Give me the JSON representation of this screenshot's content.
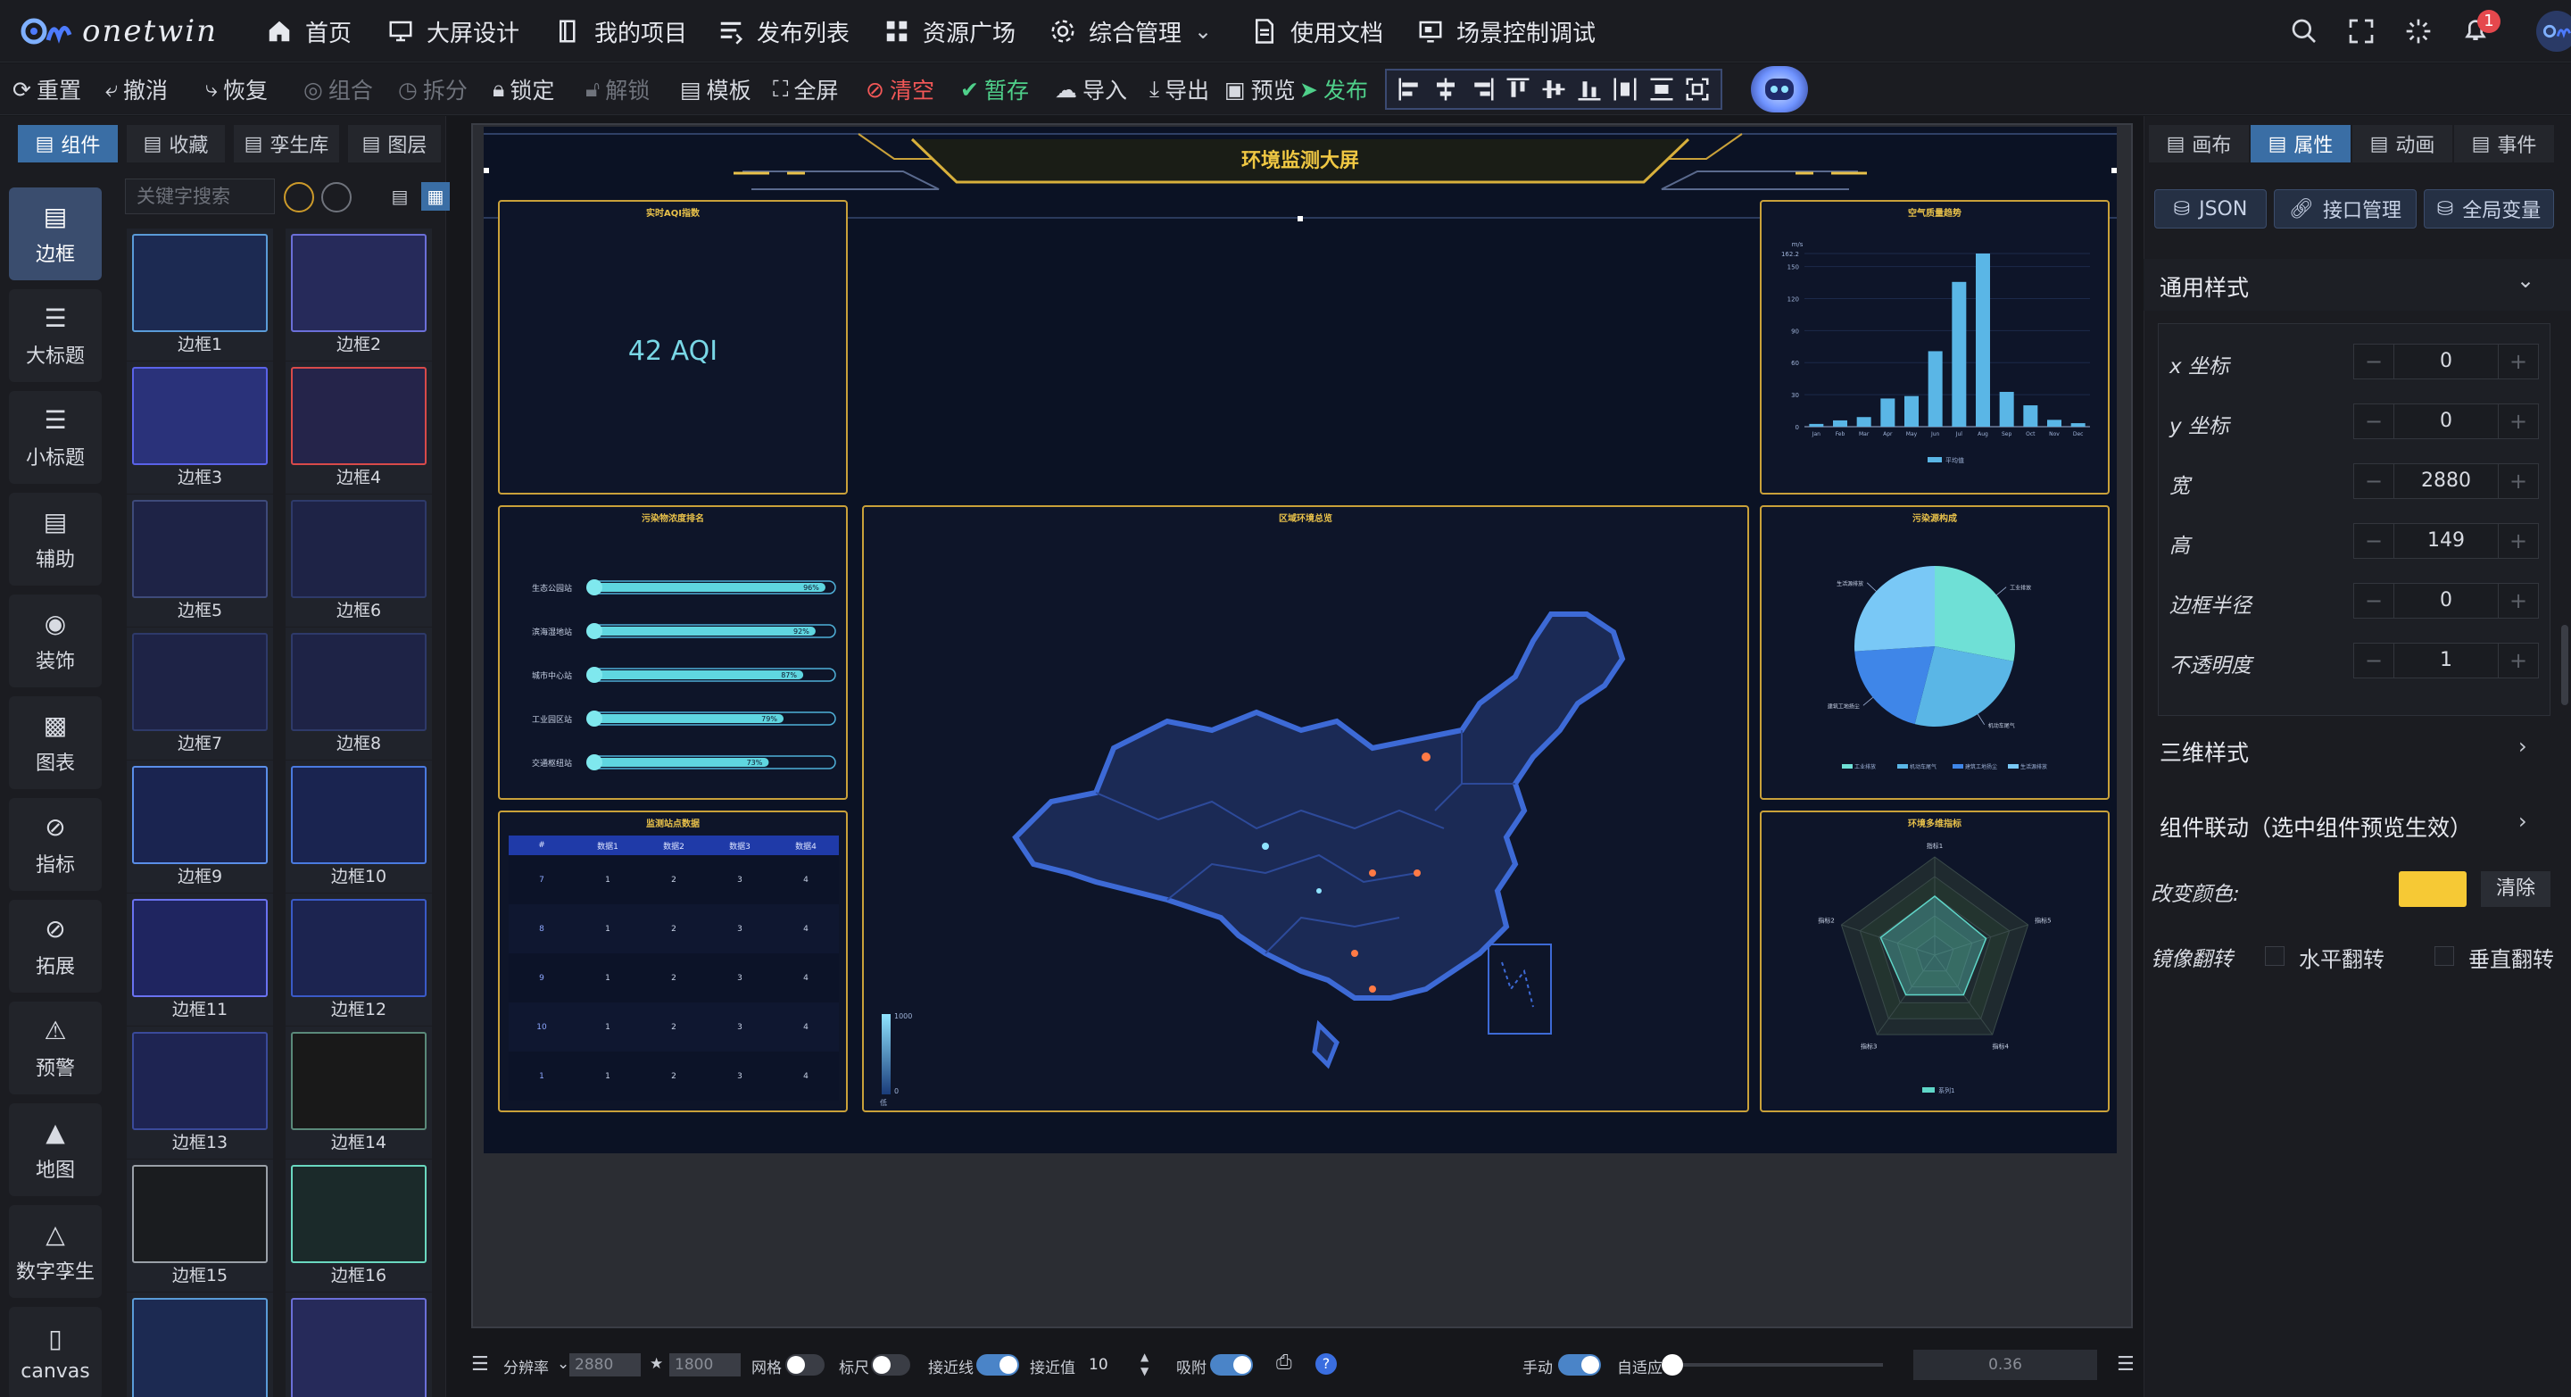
{
  "app": {
    "logo_text": "onetwin"
  },
  "nav": {
    "items": [
      "首页",
      "大屏设计",
      "我的项目",
      "发布列表",
      "资源广场",
      "综合管理",
      "使用文档",
      "场景控制调试"
    ],
    "notification_count": "1"
  },
  "toolbar": {
    "items": [
      "重置",
      "撤消",
      "恢复",
      "组合",
      "拆分",
      "锁定",
      "解锁",
      "模板",
      "全屏",
      "清空",
      "暂存",
      "导入",
      "导出",
      "预览",
      "发布"
    ]
  },
  "left_categories": [
    "边框",
    "大标题",
    "小标题",
    "辅助",
    "装饰",
    "图表",
    "指标",
    "拓展",
    "预警",
    "地图",
    "数字孪生",
    "canvas"
  ],
  "left_tabs": [
    "组件",
    "收藏",
    "孪生库",
    "图层"
  ],
  "search": {
    "placeholder": "关键字搜索"
  },
  "components": [
    "边框1",
    "边框2",
    "边框3",
    "边框4",
    "边框5",
    "边框6",
    "边框7",
    "边框8",
    "边框9",
    "边框10",
    "边框11",
    "边框12",
    "边框13",
    "边框14",
    "边框15",
    "边框16"
  ],
  "screen": {
    "title": "环境监测大屏",
    "aqi_panel_title": "实时AQI指数",
    "aqi_value": "42 AQI",
    "air_panel_title": "空气质量趋势",
    "rank_panel_title": "污染物浓度排名",
    "map_panel_title": "区域环境总览",
    "pie_panel_title": "污染源构成",
    "table_panel_title": "监测站点数据",
    "radar_panel_title": "环境多维指标",
    "map_scale_max": "1000",
    "map_scale_min": "0",
    "map_scale_label": "低",
    "table_headers": [
      "#",
      "数据1",
      "数据2",
      "数据3",
      "数据4"
    ]
  },
  "rank_data": {
    "type": "bar",
    "categories": [
      "生态公园站",
      "滨海湿地站",
      "城市中心站",
      "工业园区站",
      "交通枢纽站"
    ],
    "values": [
      96,
      92,
      87,
      79,
      73
    ],
    "value_labels": [
      "96%",
      "92%",
      "87%",
      "79%",
      "73%"
    ]
  },
  "table_rows": [
    [
      "7",
      "1",
      "2",
      "3",
      "4"
    ],
    [
      "8",
      "1",
      "2",
      "3",
      "4"
    ],
    [
      "9",
      "1",
      "2",
      "3",
      "4"
    ],
    [
      "10",
      "1",
      "2",
      "3",
      "4"
    ],
    [
      "1",
      "1",
      "2",
      "3",
      "4"
    ]
  ],
  "chart_data": [
    {
      "type": "bar",
      "title": "空气质量趋势",
      "ylabel": "m/s",
      "categories": [
        "Jan",
        "Feb",
        "Mar",
        "Apr",
        "May",
        "Jun",
        "Jul",
        "Aug",
        "Sep",
        "Oct",
        "Nov",
        "Dec"
      ],
      "yticks": [
        "0",
        "30",
        "60",
        "90",
        "120",
        "150",
        "162.2"
      ],
      "ylim": [
        0,
        162.2
      ],
      "series": [
        {
          "name": "平均值",
          "values": [
            2.6,
            5.9,
            9.0,
            26.4,
            28.7,
            70.7,
            135.6,
            162.2,
            32.6,
            20.0,
            6.4,
            3.3
          ]
        }
      ],
      "legend": "bottom"
    },
    {
      "type": "pie",
      "title": "污染源构成",
      "slices": [
        {
          "label": "工业排放",
          "value": 28,
          "color": "#6fe0d6"
        },
        {
          "label": "机动车尾气",
          "value": 26,
          "color": "#5ab6e6"
        },
        {
          "label": "建筑工地扬尘",
          "value": 20,
          "color": "#3f86e8"
        },
        {
          "label": "生活源排放",
          "value": 26,
          "color": "#79c8f6"
        }
      ],
      "legend": "bottom"
    },
    {
      "type": "radar",
      "title": "环境多维指标",
      "indicators": [
        "指标1",
        "指标5",
        "指标4",
        "指标3",
        "指标2"
      ],
      "series": [
        {
          "name": "系列1",
          "values": [
            0.6,
            0.55,
            0.5,
            0.5,
            0.58
          ]
        }
      ],
      "legend": "bottom"
    }
  ],
  "right_tabs": [
    "画布",
    "属性",
    "动画",
    "事件"
  ],
  "right_buttons": [
    "JSON",
    "接口管理",
    "全局变量"
  ],
  "general_style": {
    "title": "通用样式",
    "props": [
      {
        "label": "x 坐标",
        "value": "0"
      },
      {
        "label": "y 坐标",
        "value": "0"
      },
      {
        "label": "宽",
        "value": "2880"
      },
      {
        "label": "高",
        "value": "149"
      },
      {
        "label": "边框半径",
        "value": "0"
      },
      {
        "label": "不透明度",
        "value": "1"
      }
    ]
  },
  "sections": {
    "style3d": "三维样式",
    "linkage": "组件联动（选中组件预览生效）"
  },
  "color_change": {
    "label": "改变颜色:",
    "value": "#f6c935",
    "clear": "清除"
  },
  "mirror": {
    "label": "镜像翻转",
    "horizontal": "水平翻转",
    "vertical": "垂直翻转"
  },
  "bottombar": {
    "resolution_label": "分辨率",
    "width": "2880",
    "height": "1800",
    "grid_label": "网格",
    "ruler_label": "标尺",
    "snapline_label": "接近线",
    "snapvalue_label": "接近值",
    "snapvalue": "10",
    "adsorb_label": "吸附",
    "manual_label": "手动",
    "adaptive_label": "自适应",
    "zoom": "0.36"
  }
}
